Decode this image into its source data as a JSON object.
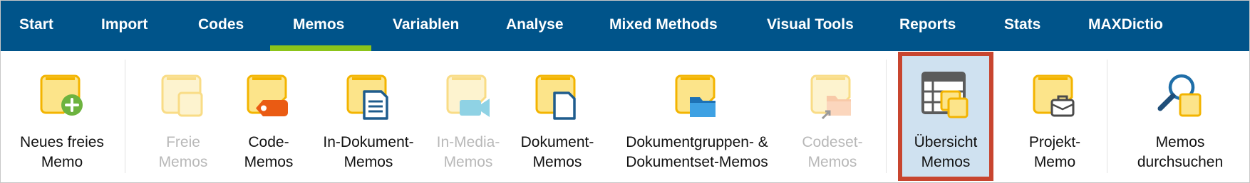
{
  "menu": {
    "tabs": [
      {
        "label": "Start"
      },
      {
        "label": "Import"
      },
      {
        "label": "Codes"
      },
      {
        "label": "Memos",
        "active": true
      },
      {
        "label": "Variablen"
      },
      {
        "label": "Analyse"
      },
      {
        "label": "Mixed Methods"
      },
      {
        "label": "Visual Tools"
      },
      {
        "label": "Reports"
      },
      {
        "label": "Stats"
      },
      {
        "label": "MAXDictio"
      }
    ]
  },
  "ribbon": {
    "items": [
      {
        "line1": "Neues freies",
        "line2": "Memo",
        "icon": "memo-plus-icon",
        "enabled": true
      },
      {
        "line1": "Freie",
        "line2": "Memos",
        "icon": "free-memos-icon",
        "enabled": false
      },
      {
        "line1": "Code-",
        "line2": "Memos",
        "icon": "code-memo-icon",
        "enabled": true
      },
      {
        "line1": "In-Dokument-",
        "line2": "Memos",
        "icon": "in-document-memo-icon",
        "enabled": true
      },
      {
        "line1": "In-Media-",
        "line2": "Memos",
        "icon": "in-media-memo-icon",
        "enabled": false
      },
      {
        "line1": "Dokument-",
        "line2": "Memos",
        "icon": "document-memo-icon",
        "enabled": true
      },
      {
        "line1": "Dokumentgruppen- &",
        "line2": "Dokumentset-Memos",
        "icon": "document-group-memo-icon",
        "enabled": true
      },
      {
        "line1": "Codeset-",
        "line2": "Memos",
        "icon": "codeset-memo-icon",
        "enabled": false
      },
      {
        "line1": "Übersicht",
        "line2": "Memos",
        "icon": "memo-overview-icon",
        "enabled": true,
        "selected": true
      },
      {
        "line1": "Projekt-",
        "line2": "Memo",
        "icon": "project-memo-icon",
        "enabled": true
      },
      {
        "line1": "Memos",
        "line2": "durchsuchen",
        "icon": "search-memos-icon",
        "enabled": true
      }
    ]
  },
  "colors": {
    "menubar": "#00548a",
    "active_underline": "#8cc41a",
    "memo_yellow": "#fce48a",
    "memo_border": "#f3b400",
    "selection_border": "#c8452f",
    "selection_fill": "#cfe1f0"
  }
}
